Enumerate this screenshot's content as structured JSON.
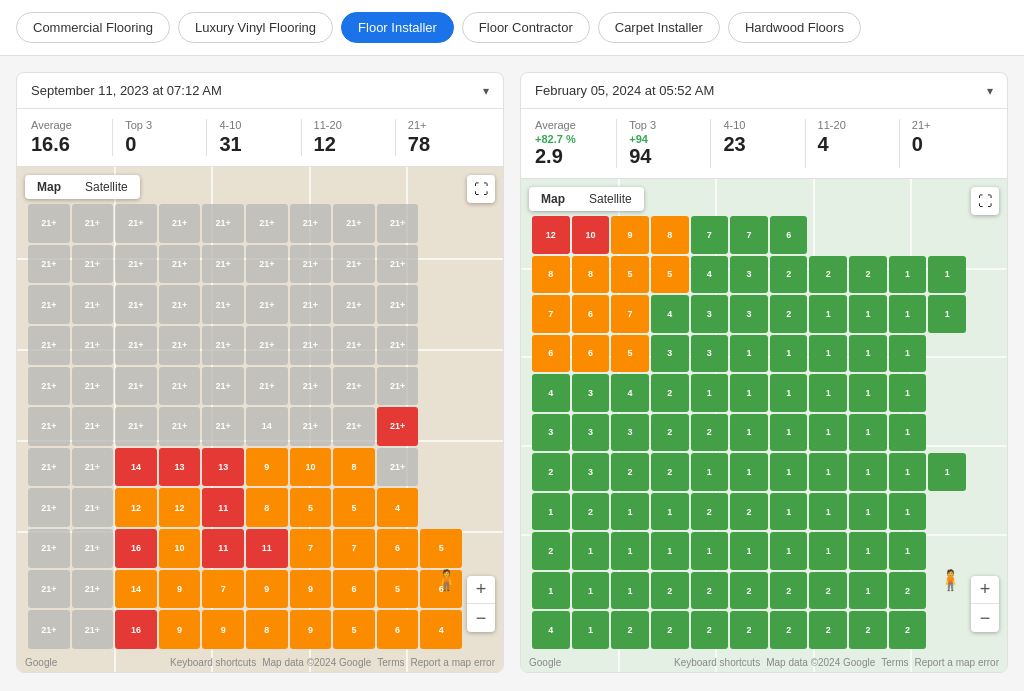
{
  "nav": {
    "tabs": [
      {
        "label": "Commercial Flooring",
        "active": false
      },
      {
        "label": "Luxury Vinyl Flooring",
        "active": false
      },
      {
        "label": "Floor Installer",
        "active": true
      },
      {
        "label": "Floor Contractor",
        "active": false
      },
      {
        "label": "Carpet Installer",
        "active": false
      },
      {
        "label": "Hardwood Floors",
        "active": false
      }
    ]
  },
  "panel_left": {
    "date": "September 11, 2023 at 07:12 AM",
    "stats": [
      {
        "label": "Average",
        "value": "16.6",
        "badge": ""
      },
      {
        "label": "Top 3",
        "value": "0",
        "badge": ""
      },
      {
        "label": "4-10",
        "value": "31",
        "badge": ""
      },
      {
        "label": "11-20",
        "value": "12",
        "badge": ""
      },
      {
        "label": "21+",
        "value": "78",
        "badge": ""
      }
    ],
    "map_tab_map": "Map",
    "map_tab_satellite": "Satellite"
  },
  "panel_right": {
    "date": "February 05, 2024 at 05:52 AM",
    "stats": [
      {
        "label": "Average",
        "value": "2.9",
        "badge": "+82.7 %"
      },
      {
        "label": "Top 3",
        "value": "94",
        "badge": "+94"
      },
      {
        "label": "4-10",
        "value": "23",
        "badge": ""
      },
      {
        "label": "11-20",
        "value": "4",
        "badge": ""
      },
      {
        "label": "21+",
        "value": "0",
        "badge": ""
      }
    ],
    "map_tab_map": "Map",
    "map_tab_satellite": "Satellite"
  },
  "icons": {
    "chevron": "▾",
    "fullscreen": "⛶",
    "zoom_in": "+",
    "zoom_out": "−",
    "google": "Google",
    "person": "🧍"
  },
  "map_footer": "Keyboard shortcuts  Map data ©2024 Google  Terms  Report a map error",
  "left_grid": [
    [
      "21+",
      "21+",
      "21+",
      "21+",
      "21+",
      "21+",
      "21+",
      "21+",
      "21+"
    ],
    [
      "21+",
      "21+",
      "21+",
      "21+",
      "21+",
      "21+",
      "21+",
      "21+",
      "21+"
    ],
    [
      "21+",
      "21+",
      "21+",
      "21+",
      "21+",
      "21+",
      "21+",
      "21+",
      "21+"
    ],
    [
      "21+",
      "21+",
      "21+",
      "21+",
      "21+",
      "21+",
      "21+",
      "21+",
      "21+"
    ],
    [
      "21+",
      "21+",
      "21+",
      "21+",
      "21+",
      "21+",
      "21+",
      "21+",
      "21+"
    ],
    [
      "21+",
      "21+",
      "21+",
      "21+",
      "21+",
      "14",
      "21+",
      "21+",
      "21+"
    ],
    [
      "21+",
      "21+",
      "14",
      "13",
      "13",
      "9",
      "10",
      "8",
      "21+"
    ],
    [
      "21+",
      "21+",
      "12",
      "12",
      "11",
      "8",
      "5",
      "5",
      "4"
    ],
    [
      "21+",
      "21+",
      "16",
      "10",
      "11",
      "11",
      "7",
      "7",
      "6",
      "5"
    ],
    [
      "21+",
      "21+",
      "14",
      "9",
      "7",
      "9",
      "9",
      "6",
      "5",
      "6"
    ],
    [
      "21+",
      "21+",
      "16",
      "9",
      "9",
      "8",
      "9",
      "5",
      "6",
      "4"
    ]
  ],
  "left_grid_colors": [
    [
      "gray",
      "gray",
      "gray",
      "gray",
      "gray",
      "gray",
      "gray",
      "gray",
      "gray"
    ],
    [
      "gray",
      "gray",
      "gray",
      "gray",
      "gray",
      "gray",
      "gray",
      "gray",
      "gray"
    ],
    [
      "gray",
      "gray",
      "gray",
      "gray",
      "gray",
      "gray",
      "gray",
      "gray",
      "gray"
    ],
    [
      "gray",
      "gray",
      "gray",
      "gray",
      "gray",
      "gray",
      "gray",
      "gray",
      "gray"
    ],
    [
      "gray",
      "gray",
      "gray",
      "gray",
      "gray",
      "gray",
      "gray",
      "gray",
      "gray"
    ],
    [
      "gray",
      "gray",
      "gray",
      "gray",
      "gray",
      "gray",
      "gray",
      "gray",
      "red",
      "gray"
    ],
    [
      "gray",
      "gray",
      "red",
      "red",
      "red",
      "orange",
      "orange",
      "orange",
      "gray",
      "orange"
    ],
    [
      "gray",
      "gray",
      "orange",
      "orange",
      "red",
      "orange",
      "orange",
      "orange",
      "orange"
    ],
    [
      "gray",
      "gray",
      "red",
      "orange",
      "red",
      "red",
      "orange",
      "orange",
      "orange",
      "orange"
    ],
    [
      "gray",
      "gray",
      "orange",
      "orange",
      "orange",
      "orange",
      "orange",
      "orange",
      "orange",
      "orange"
    ],
    [
      "gray",
      "gray",
      "red",
      "orange",
      "orange",
      "orange",
      "orange",
      "orange",
      "orange",
      "orange"
    ]
  ],
  "right_grid": [
    [
      "12",
      "10",
      "9",
      "8",
      "7",
      "7",
      "6"
    ],
    [
      "8",
      "8",
      "5",
      "5",
      "4",
      "3",
      "2",
      "2",
      "2",
      "1",
      "1"
    ],
    [
      "7",
      "6",
      "7",
      "4",
      "3",
      "3",
      "2",
      "1",
      "1",
      "1",
      "1"
    ],
    [
      "6",
      "6",
      "5",
      "3",
      "3",
      "1",
      "1",
      "1",
      "1",
      "1"
    ],
    [
      "4",
      "3",
      "4",
      "2",
      "1",
      "1",
      "1",
      "1",
      "1",
      "1"
    ],
    [
      "3",
      "3",
      "3",
      "2",
      "2",
      "1",
      "1",
      "1",
      "1",
      "1"
    ],
    [
      "2",
      "3",
      "2",
      "2",
      "1",
      "1",
      "1",
      "1",
      "1",
      "1",
      "1"
    ],
    [
      "1",
      "2",
      "1",
      "1",
      "2",
      "2",
      "1",
      "1",
      "1",
      "1"
    ],
    [
      "2",
      "1",
      "1",
      "1",
      "1",
      "1",
      "1",
      "1",
      "1",
      "1"
    ],
    [
      "1",
      "1",
      "1",
      "2",
      "2",
      "2",
      "2",
      "2",
      "1",
      "2"
    ],
    [
      "4",
      "1",
      "2",
      "2",
      "2",
      "2",
      "2",
      "2",
      "2",
      "2"
    ]
  ],
  "right_grid_colors": [
    [
      "red",
      "red",
      "orange",
      "orange",
      "green",
      "green",
      "green"
    ],
    [
      "orange",
      "orange",
      "orange",
      "orange",
      "green",
      "green",
      "green",
      "green",
      "green",
      "green",
      "green"
    ],
    [
      "orange",
      "orange",
      "orange",
      "green",
      "green",
      "green",
      "green",
      "green",
      "green",
      "green",
      "green"
    ],
    [
      "orange",
      "orange",
      "orange",
      "green",
      "green",
      "green",
      "green",
      "green",
      "green",
      "green"
    ],
    [
      "green",
      "green",
      "green",
      "green",
      "green",
      "green",
      "green",
      "green",
      "green",
      "green"
    ],
    [
      "green",
      "green",
      "green",
      "green",
      "green",
      "green",
      "green",
      "green",
      "green",
      "green"
    ],
    [
      "green",
      "green",
      "green",
      "green",
      "green",
      "green",
      "green",
      "green",
      "green",
      "green",
      "green"
    ],
    [
      "green",
      "green",
      "green",
      "green",
      "green",
      "green",
      "green",
      "green",
      "green",
      "green"
    ],
    [
      "green",
      "green",
      "green",
      "green",
      "green",
      "green",
      "green",
      "green",
      "green",
      "green"
    ],
    [
      "green",
      "green",
      "green",
      "green",
      "green",
      "green",
      "green",
      "green",
      "green",
      "green"
    ],
    [
      "green",
      "green",
      "green",
      "green",
      "green",
      "green",
      "green",
      "green",
      "green",
      "green"
    ]
  ]
}
